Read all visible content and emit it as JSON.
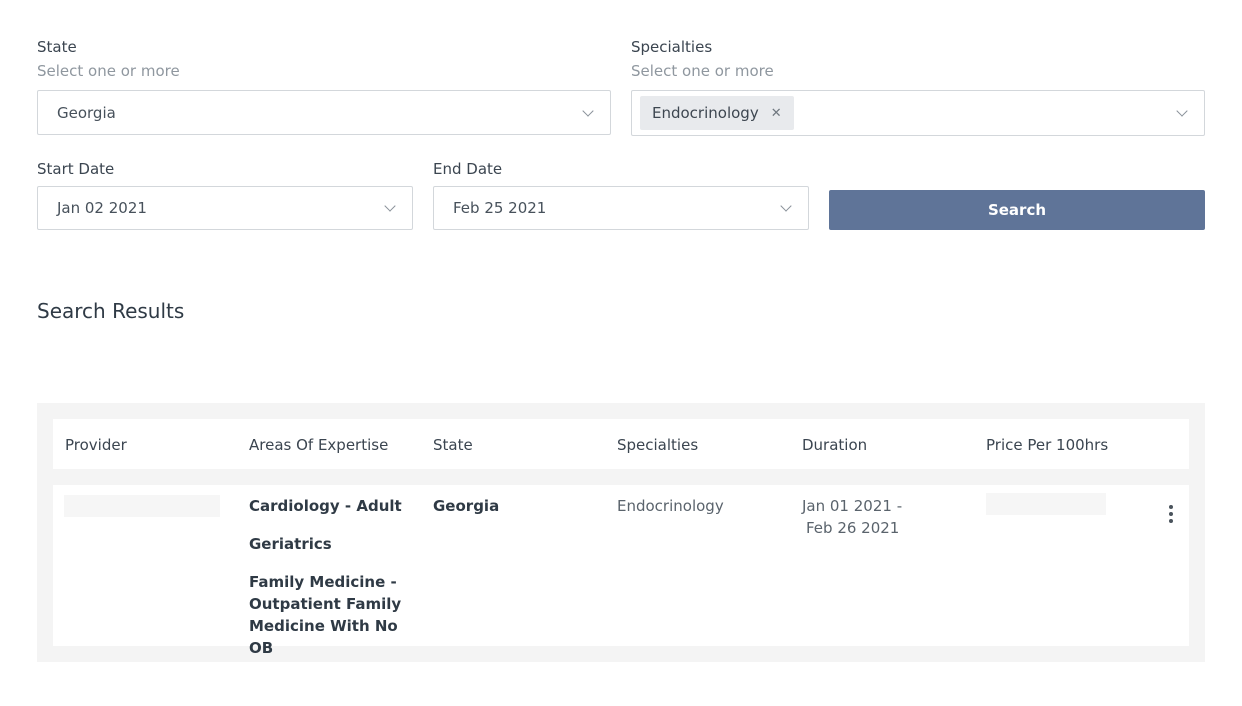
{
  "filters": {
    "state": {
      "label": "State",
      "hint": "Select one or more",
      "value": "Georgia"
    },
    "specialties": {
      "label": "Specialties",
      "hint": "Select one or more",
      "chips": [
        "Endocrinology"
      ]
    },
    "start_date": {
      "label": "Start Date",
      "value": "Jan 02 2021"
    },
    "end_date": {
      "label": "End Date",
      "value": "Feb 25 2021"
    },
    "search_label": "Search"
  },
  "results": {
    "title": "Search Results",
    "columns": [
      "Provider",
      "Areas Of Expertise",
      "State",
      "Specialties",
      "Duration",
      "Price Per 100hrs"
    ],
    "rows": [
      {
        "areas": [
          "Cardiology - Adult",
          "Geriatrics",
          "Family Medicine - Outpatient Family Medicine With No OB"
        ],
        "state": "Georgia",
        "specialties": "Endocrinology",
        "duration_start": "Jan 01 2021 -",
        "duration_end": "Feb 26 2021"
      }
    ]
  },
  "icons": [
    "chevron-down-icon",
    "close-icon",
    "more-vertical-icon"
  ],
  "colors": {
    "accent": "#5f7498",
    "panel": "#f4f4f4",
    "chip": "#e8eaed"
  }
}
